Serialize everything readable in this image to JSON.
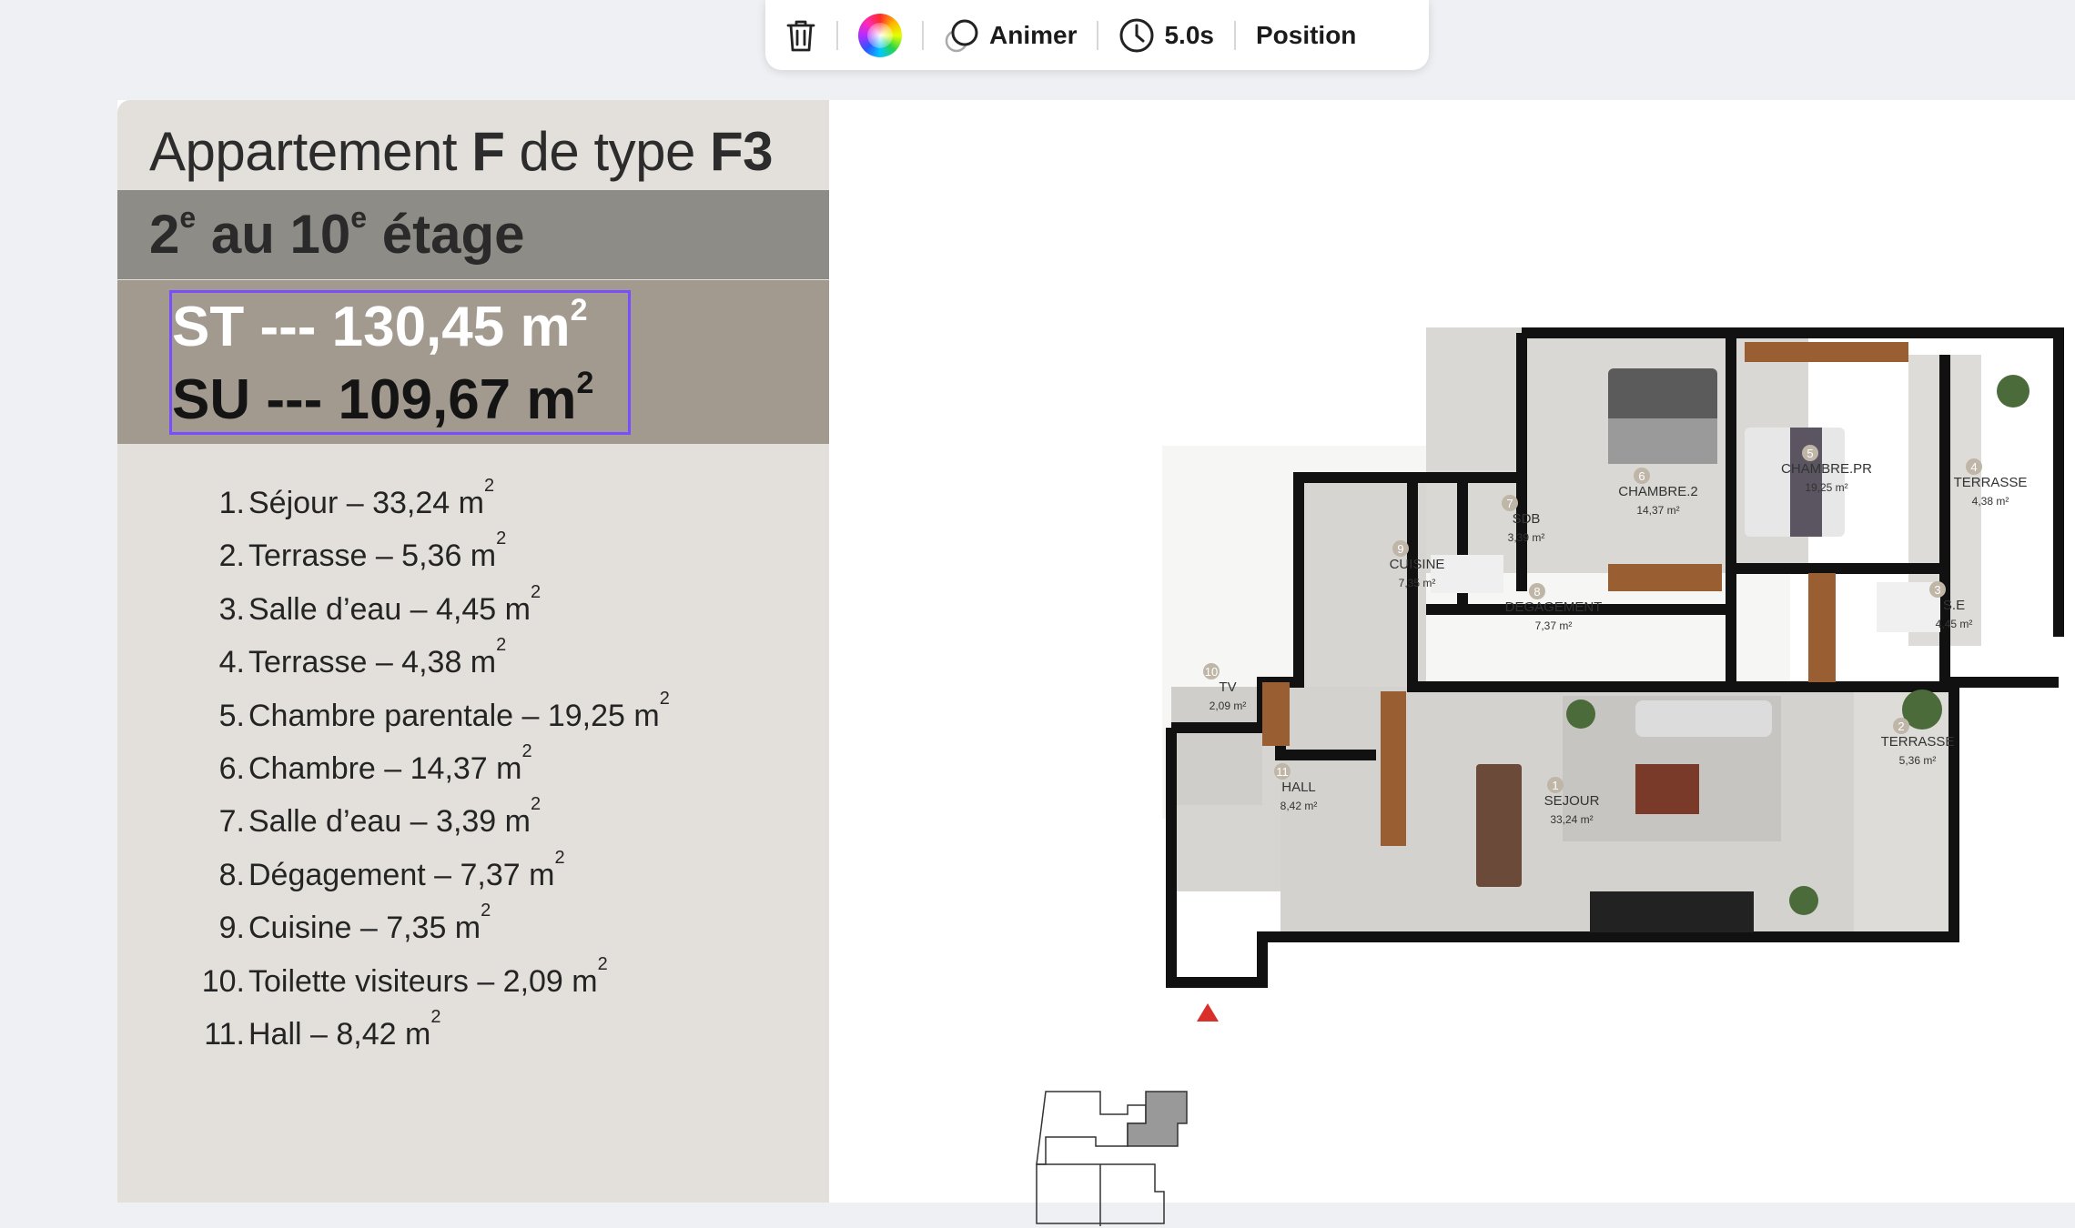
{
  "toolbar": {
    "delete_label": "",
    "animate_label": "Animer",
    "duration_label": "5.0s",
    "position_label": "Position"
  },
  "sidebar": {
    "title_part1": "Appartement ",
    "title_bold1": "F",
    "title_part2": " de type ",
    "title_bold2": "F3",
    "floor_num1": "2",
    "floor_sup1": "e",
    "floor_mid": " au 10",
    "floor_sup2": "e",
    "floor_end": " étage",
    "st_text": "ST --- 130,45 m",
    "su_text": "SU --- 109,67 m",
    "sup": "2",
    "rooms": [
      {
        "num": "1.",
        "label": "Séjour – 33,24 m"
      },
      {
        "num": "2.",
        "label": "Terrasse – 5,36 m"
      },
      {
        "num": "3.",
        "label": "Salle d’eau – 4,45 m"
      },
      {
        "num": "4.",
        "label": "Terrasse – 4,38 m"
      },
      {
        "num": "5.",
        "label": "Chambre parentale – 19,25 m"
      },
      {
        "num": "6.",
        "label": "Chambre – 14,37 m"
      },
      {
        "num": "7.",
        "label": "Salle d’eau – 3,39 m"
      },
      {
        "num": "8.",
        "label": "Dégagement – 7,37 m"
      },
      {
        "num": "9.",
        "label": "Cuisine – 7,35 m"
      },
      {
        "num": "10.",
        "label": "Toilette visiteurs – 2,09 m"
      },
      {
        "num": "11.",
        "label": "Hall – 8,42 m"
      }
    ]
  },
  "plan": {
    "labels": [
      {
        "name": "CHAMBRE.2",
        "area": "14,37 m²",
        "num": "6"
      },
      {
        "name": "CHAMBRE.PR",
        "area": "19,25 m²",
        "num": "5"
      },
      {
        "name": "TERRASSE",
        "area": "4,38 m²",
        "num": "4"
      },
      {
        "name": "SDB",
        "area": "3,39 m²",
        "num": "7"
      },
      {
        "name": "CUISINE",
        "area": "7,35 m²",
        "num": "9"
      },
      {
        "name": "DEGAGEMENT",
        "area": "7,37 m²",
        "num": "8"
      },
      {
        "name": "S.E",
        "area": "4,45 m²",
        "num": "3"
      },
      {
        "name": "TV",
        "area": "2,09 m²",
        "num": "10"
      },
      {
        "name": "HALL",
        "area": "8,42 m²",
        "num": "11"
      },
      {
        "name": "SEJOUR",
        "area": "33,24 m²",
        "num": "1"
      },
      {
        "name": "TERRASSE",
        "area": "5,36 m²",
        "num": "2"
      }
    ]
  },
  "colors": {
    "accent_selection": "#7a4dff",
    "floor_band": "#8d8c87",
    "area_band": "#a29a8e",
    "sidebar_bg": "#e3e0db",
    "entrance_marker": "#d9302c"
  },
  "icons": [
    "trash-icon",
    "color-wheel-icon",
    "animate-icon",
    "clock-icon",
    "entrance-arrow-icon"
  ]
}
